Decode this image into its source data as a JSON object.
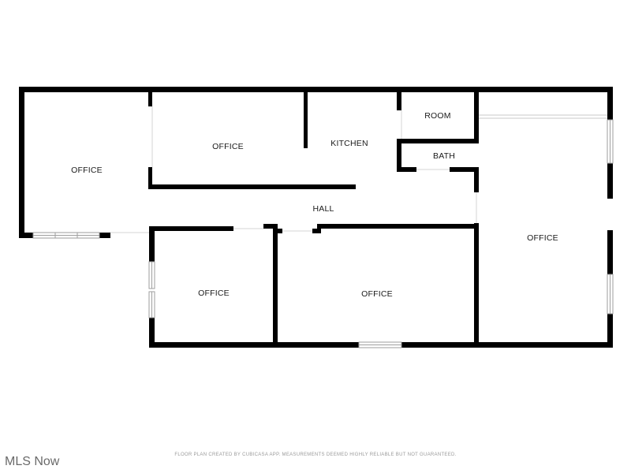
{
  "rooms": {
    "office_west": "OFFICE",
    "office_north": "OFFICE",
    "kitchen": "KITCHEN",
    "room": "ROOM",
    "bath": "BATH",
    "hall": "HALL",
    "office_east": "OFFICE",
    "office_southwest": "OFFICE",
    "office_south": "OFFICE"
  },
  "footer": {
    "disclaimer": "FLOOR PLAN CREATED BY CUBICASA APP. MEASUREMENTS DEEMED HIGHLY RELIABLE BUT NOT GUARANTEED."
  },
  "watermark": {
    "text": "MLS Now"
  },
  "colors": {
    "wall": "#000000",
    "background": "#ffffff",
    "window": "#9e9e9e"
  }
}
